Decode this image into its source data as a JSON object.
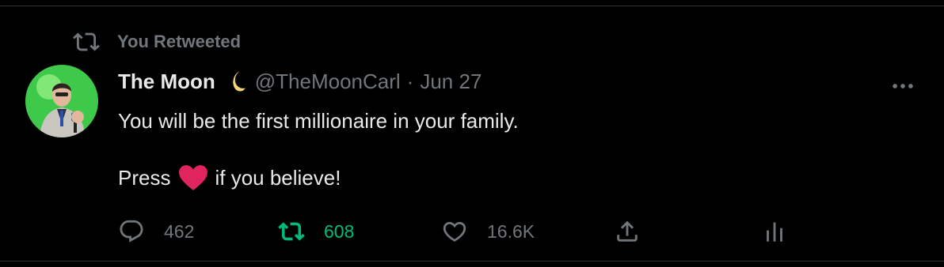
{
  "retweet_context": {
    "label": "You Retweeted"
  },
  "author": {
    "name": "The Moon",
    "handle": "@TheMoonCarl",
    "separator": "·",
    "date": "Jun 27"
  },
  "tweet": {
    "line1": "You will be the first millionaire in your family.",
    "line2_before": "Press",
    "line2_after": "if you believe!"
  },
  "actions": {
    "replies": "462",
    "retweets": "608",
    "likes": "16.6K"
  },
  "colors": {
    "background": "#000000",
    "text": "#e7e9ea",
    "muted": "#71767b",
    "retweeted_green": "#00ba7c",
    "heart_red": "#e0245e"
  }
}
